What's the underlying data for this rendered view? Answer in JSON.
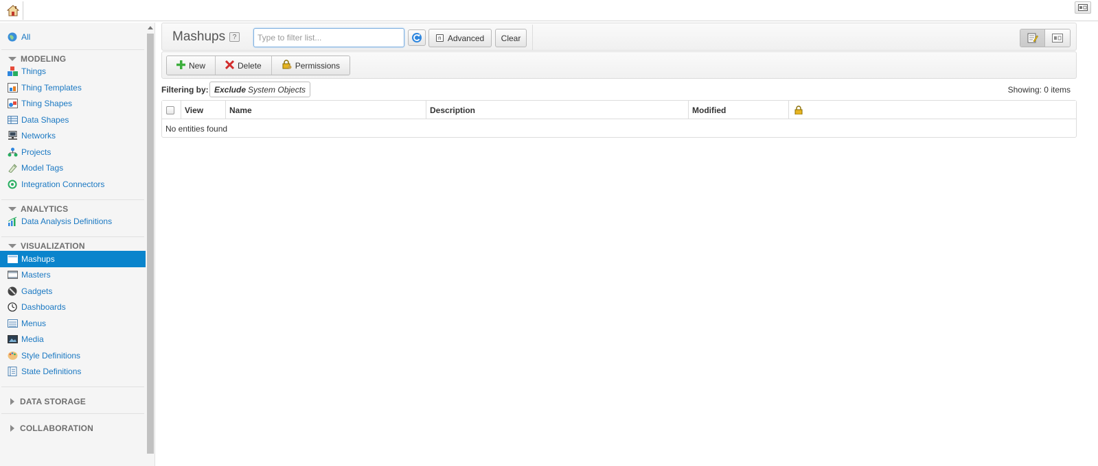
{
  "sidebar": {
    "all_label": "All",
    "sections": {
      "modeling": "MODELING",
      "analytics": "ANALYTICS",
      "visualization": "VISUALIZATION",
      "data_storage": "DATA STORAGE",
      "collaboration": "COLLABORATION"
    },
    "modeling_items": [
      "Things",
      "Thing Templates",
      "Thing Shapes",
      "Data Shapes",
      "Networks",
      "Projects",
      "Model Tags",
      "Integration Connectors"
    ],
    "analytics_items": [
      "Data Analysis Definitions"
    ],
    "visualization_items": [
      "Mashups",
      "Masters",
      "Gadgets",
      "Dashboards",
      "Menus",
      "Media",
      "Style Definitions",
      "State Definitions"
    ],
    "active_item": "Mashups"
  },
  "header": {
    "title": "Mashups",
    "help": "?",
    "filter_placeholder": "Type to filter list...",
    "advanced_label": "Advanced",
    "clear_label": "Clear"
  },
  "actions": {
    "new_label": "New",
    "delete_label": "Delete",
    "permissions_label": "Permissions"
  },
  "filter": {
    "label": "Filtering by:",
    "chip_bold": "Exclude",
    "chip_text": "System Objects",
    "showing": "Showing: 0 items"
  },
  "grid": {
    "columns": [
      "View",
      "Name",
      "Description",
      "Modified"
    ],
    "empty_text": "No entities found"
  },
  "colors": {
    "accent": "#0a84cc",
    "link": "#1a78c2"
  }
}
